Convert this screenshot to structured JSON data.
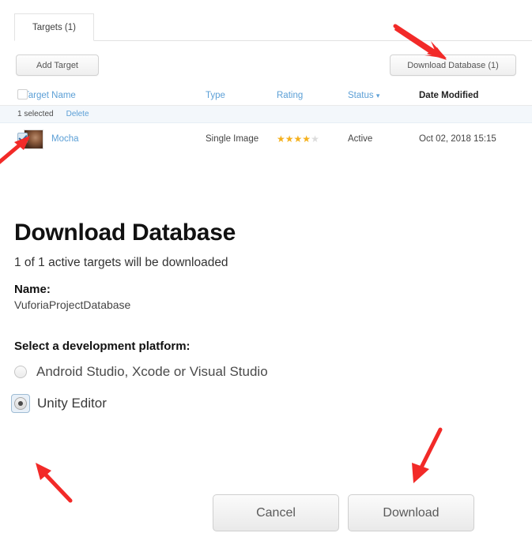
{
  "tabs": [
    {
      "label": "Targets (1)",
      "active": true
    }
  ],
  "toolbar": {
    "add_target_label": "Add Target",
    "download_database_label": "Download Database (1)"
  },
  "table": {
    "columns": [
      {
        "key": "name",
        "label": "Target Name",
        "sorted": false
      },
      {
        "key": "type",
        "label": "Type",
        "sorted": false
      },
      {
        "key": "rating",
        "label": "Rating",
        "sorted": false
      },
      {
        "key": "status",
        "label": "Status",
        "sorted": false,
        "has_chevron": true
      },
      {
        "key": "date",
        "label": "Date Modified",
        "sorted": true
      }
    ],
    "selection_bar": {
      "count_label": "1 selected",
      "delete_label": "Delete"
    },
    "rows": [
      {
        "checked": true,
        "name": "Mocha",
        "type": "Single Image",
        "rating": 4,
        "rating_max": 5,
        "status": "Active",
        "date_modified": "Oct 02, 2018 15:15"
      }
    ]
  },
  "panel": {
    "title": "Download Database",
    "subtitle": "1 of 1 active targets will be downloaded",
    "name_label": "Name:",
    "name_value": "VuforiaProjectDatabase",
    "platform_section_label": "Select a development platform:",
    "platform_options": [
      {
        "label": "Android Studio, Xcode or Visual Studio",
        "selected": false,
        "focused": false
      },
      {
        "label": "Unity Editor",
        "selected": true,
        "focused": true
      }
    ]
  },
  "footer": {
    "cancel_label": "Cancel",
    "download_label": "Download"
  },
  "icons": {
    "chevron_down": "⌄",
    "star_filled": "★",
    "star_empty": "★"
  },
  "colors": {
    "link": "#5b9fd6",
    "star_on": "#f5b11e",
    "star_off": "#dcdcdc",
    "annotation_arrow": "#f22a28",
    "selection_bar_bg": "#f3f7fb"
  },
  "annotations": [
    {
      "name": "arrow-to-download-database-button",
      "color": "#f22a28"
    },
    {
      "name": "arrow-to-row-checkbox",
      "color": "#f22a28"
    },
    {
      "name": "arrow-to-unity-editor-radio",
      "color": "#f22a28"
    },
    {
      "name": "arrow-to-download-button",
      "color": "#f22a28"
    }
  ]
}
